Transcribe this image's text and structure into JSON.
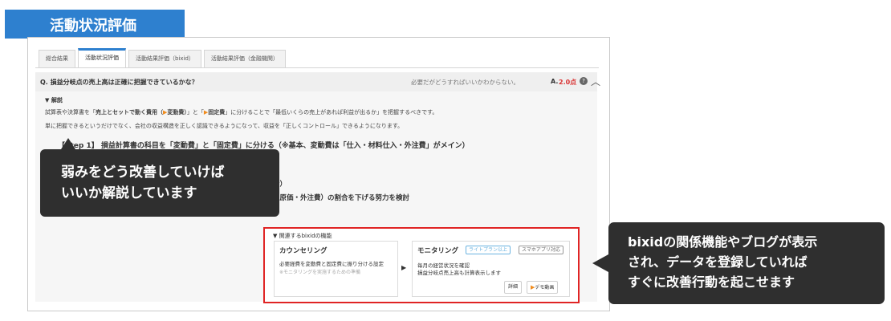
{
  "header": {
    "title": "活動状況評価"
  },
  "tabs": [
    {
      "label": "総合結果"
    },
    {
      "label": "活動状況評価"
    },
    {
      "label": "活動結果評価（bixid）"
    },
    {
      "label": "活動結果評価（金融機関）"
    }
  ],
  "question": {
    "text": "Q. 損益分岐点の売上高は正確に把握できているかな？",
    "hint": "必要だがどうすればいいかわからない。",
    "answer_label": "A.",
    "score": "2.0点",
    "help_icon": "question-circle-icon",
    "collapse_icon": "chevron-up-icon"
  },
  "explanation": {
    "toggle": "▼ 解説",
    "line1_a": "試算表や決算書を「",
    "line1_b": "売上とセットで動く費用（",
    "line1_c": "変動費）",
    "line1_d": "」と「",
    "line1_e": "固定費",
    "line1_f": "」に分けることで「最低いくらの売上があれば利益が出るか」を把握するべきです。",
    "line2": "単に把握できるというだけでなく、会社の収益構造を正しく認識できるようになって、収益を「正しくコントロール」できるようになります。",
    "step1": "【Step 1】 損益計算書の科目を「変動費」と「固定費」に分ける（※基本、変動費は「仕入・材料仕入・外注費」がメイン）",
    "partial1": "討）",
    "partial2": "入原価・外注費）の割合を下げる努力を検討"
  },
  "callout_left": {
    "line1": "弱みをどう改善していけば",
    "line2": "いいか解説しています"
  },
  "related": {
    "header": "▼ 関連するbixidの機能",
    "card1": {
      "title": "カウンセリング",
      "desc": "必要経費を変動費と固定費に振り分ける設定",
      "note": "※モニタリングを実施するための準備"
    },
    "card2": {
      "title": "モニタリング",
      "badge1": "ライトプラン以上",
      "badge2": "スマホアプリ対応",
      "desc1": "毎月の経営状況を確認",
      "desc2": "損益分岐点売上高も計算表示します",
      "detail_button": "詳細",
      "demo_button": "デモ動画"
    }
  },
  "callout_right": {
    "line1": "bixidの関係機能やブログが表示",
    "line2": "され、データを登録していれば",
    "line3": "すぐに改善行動を起こせます"
  },
  "colors": {
    "accent": "#2e80cf",
    "score": "#d93232",
    "highlight_border": "#e02424",
    "callout_bg": "#2f2f2f"
  }
}
